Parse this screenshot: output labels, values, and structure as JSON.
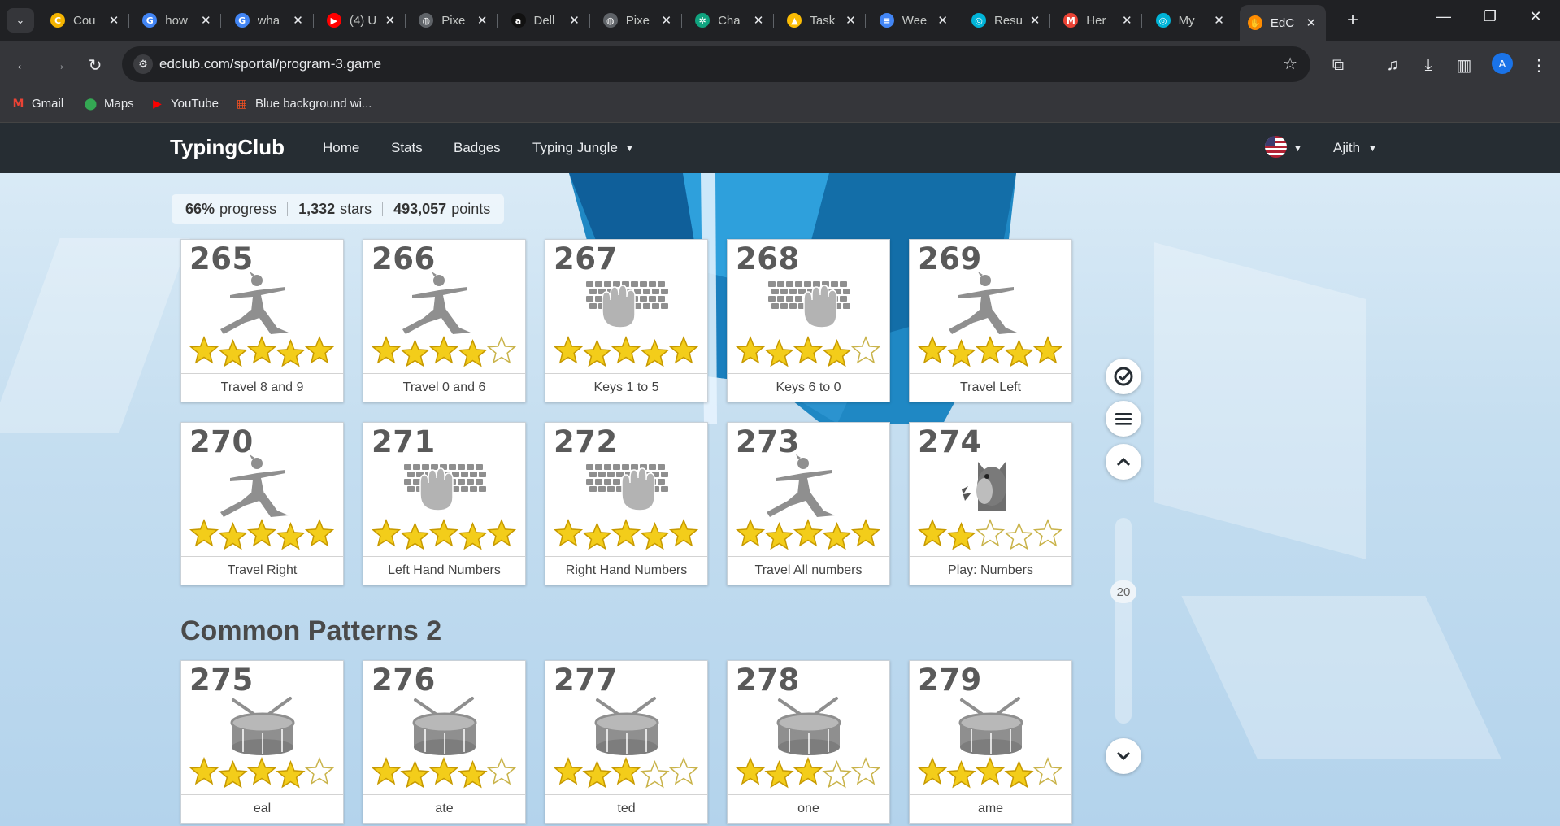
{
  "browser": {
    "tabs": [
      {
        "title": "Cou",
        "icon": "coursera-icon",
        "color": "#f4b400",
        "glyph": "C"
      },
      {
        "title": "how",
        "icon": "google-icon",
        "color": "#4285f4",
        "glyph": "G"
      },
      {
        "title": "wha",
        "icon": "google-icon",
        "color": "#4285f4",
        "glyph": "G"
      },
      {
        "title": "(4) U",
        "icon": "youtube-icon",
        "color": "#ff0000",
        "glyph": "▶"
      },
      {
        "title": "Pixe",
        "icon": "globe-icon",
        "color": "#5f6368",
        "glyph": "◍"
      },
      {
        "title": "Dell",
        "icon": "amazon-icon",
        "color": "#111111",
        "glyph": "a"
      },
      {
        "title": "Pixe",
        "icon": "globe-icon",
        "color": "#5f6368",
        "glyph": "◍"
      },
      {
        "title": "Cha",
        "icon": "chatgpt-icon",
        "color": "#10a37f",
        "glyph": "✲"
      },
      {
        "title": "Task",
        "icon": "drive-icon",
        "color": "#fbbc04",
        "glyph": "▲"
      },
      {
        "title": "Wee",
        "icon": "docs-icon",
        "color": "#4285f4",
        "glyph": "≡"
      },
      {
        "title": "Resu",
        "icon": "resume-icon",
        "color": "#00b4d8",
        "glyph": "◎"
      },
      {
        "title": "Her",
        "icon": "gmail-icon",
        "color": "#ea4335",
        "glyph": "M"
      },
      {
        "title": "My",
        "icon": "resume-icon",
        "color": "#00b4d8",
        "glyph": "◎"
      },
      {
        "title": "EdC",
        "icon": "edclub-icon",
        "color": "#ff8c00",
        "glyph": "✋"
      }
    ],
    "url": "edclub.com/sportal/program-3.game",
    "avatar_letter": "A",
    "bookmarks": [
      {
        "label": "Gmail",
        "icon": "gmail-icon",
        "color": "#ea4335",
        "glyph": "M"
      },
      {
        "label": "Maps",
        "icon": "maps-icon",
        "color": "#34a853",
        "glyph": "⬤"
      },
      {
        "label": "YouTube",
        "icon": "youtube-icon",
        "color": "#ff0000",
        "glyph": "▶"
      },
      {
        "label": "Blue background wi...",
        "icon": "microsoft-icon",
        "color": "#f25022",
        "glyph": "▦"
      }
    ]
  },
  "site": {
    "brand": "TypingClub",
    "nav": [
      "Home",
      "Stats",
      "Badges",
      "Typing Jungle"
    ],
    "user": "Ajith"
  },
  "progress": {
    "percent": "66%",
    "percent_label": "progress",
    "stars": "1,332",
    "stars_label": "stars",
    "points": "493,057",
    "points_label": "points"
  },
  "lessons": [
    {
      "num": "265",
      "label": "Travel 8 and 9",
      "icon": "yoga-icon",
      "stars": 5
    },
    {
      "num": "266",
      "label": "Travel 0 and 6",
      "icon": "yoga-icon",
      "stars": 4
    },
    {
      "num": "267",
      "label": "Keys 1 to 5",
      "icon": "keyboard-left-hand-icon",
      "stars": 5
    },
    {
      "num": "268",
      "label": "Keys 6 to 0",
      "icon": "keyboard-right-hand-icon",
      "stars": 4
    },
    {
      "num": "269",
      "label": "Travel Left",
      "icon": "yoga-icon",
      "stars": 5
    },
    {
      "num": "270",
      "label": "Travel Right",
      "icon": "yoga-icon",
      "stars": 5
    },
    {
      "num": "271",
      "label": "Left Hand Numbers",
      "icon": "keyboard-left-hand-icon",
      "stars": 5
    },
    {
      "num": "272",
      "label": "Right Hand Numbers",
      "icon": "keyboard-right-hand-icon",
      "stars": 5
    },
    {
      "num": "273",
      "label": "Travel All numbers",
      "icon": "yoga-icon",
      "stars": 5
    },
    {
      "num": "274",
      "label": "Play: Numbers",
      "icon": "monster-game-icon",
      "stars": 2
    }
  ],
  "section": {
    "title": "Common Patterns 2",
    "lessons": [
      {
        "num": "275",
        "label": "eal",
        "icon": "drum-icon",
        "stars": 4
      },
      {
        "num": "276",
        "label": "ate",
        "icon": "drum-icon",
        "stars": 4
      },
      {
        "num": "277",
        "label": "ted",
        "icon": "drum-icon",
        "stars": 3
      },
      {
        "num": "278",
        "label": "one",
        "icon": "drum-icon",
        "stars": 3
      },
      {
        "num": "279",
        "label": "ame",
        "icon": "drum-icon",
        "stars": 4
      }
    ]
  },
  "scroller": {
    "value": "20"
  },
  "colors": {
    "star_on": "#f3cd1a",
    "star_on_edge": "#c79a00",
    "star_off": "#ffffff",
    "art": "#8f8f8f"
  }
}
